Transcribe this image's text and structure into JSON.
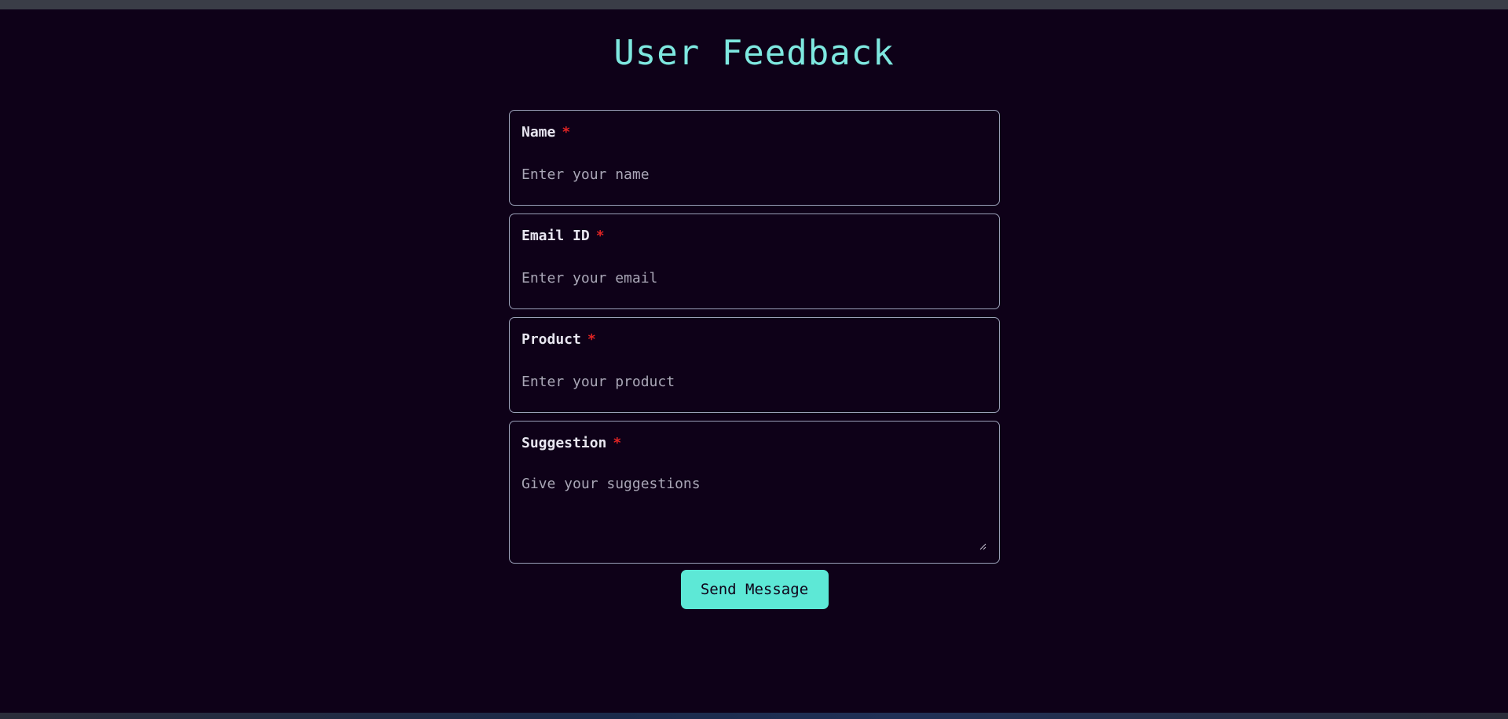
{
  "page": {
    "title": "User Feedback"
  },
  "form": {
    "fields": [
      {
        "label": "Name",
        "required_marker": "*",
        "placeholder": "Enter your name",
        "value": ""
      },
      {
        "label": "Email ID",
        "required_marker": "*",
        "placeholder": "Enter your email",
        "value": ""
      },
      {
        "label": "Product",
        "required_marker": "*",
        "placeholder": "Enter your product",
        "value": ""
      },
      {
        "label": "Suggestion",
        "required_marker": "*",
        "placeholder": "Give your suggestions",
        "value": ""
      }
    ],
    "submit_label": "Send Message"
  },
  "colors": {
    "background": "#0e0118",
    "title": "#7ee8e0",
    "label": "#e8e6f0",
    "required": "#e02424",
    "field_border": "#9aa0b8",
    "button": "#5de8d6",
    "button_text": "#0e0118"
  },
  "icons": {
    "resize_handle": "resize-grip-icon"
  }
}
